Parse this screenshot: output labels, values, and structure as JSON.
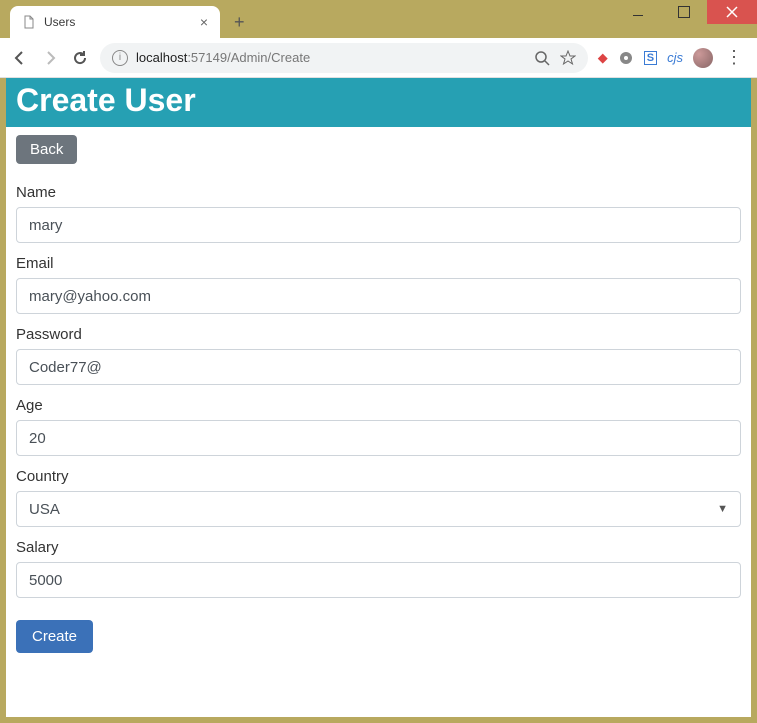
{
  "browser": {
    "tab_title": "Users",
    "url_host": "localhost",
    "url_port": ":57149",
    "url_path": "/Admin/Create",
    "ext_cjs": "cjs"
  },
  "page": {
    "heading": "Create User",
    "back_label": "Back",
    "submit_label": "Create"
  },
  "form": {
    "name": {
      "label": "Name",
      "value": "mary"
    },
    "email": {
      "label": "Email",
      "value": "mary@yahoo.com"
    },
    "password": {
      "label": "Password",
      "value": "Coder77@"
    },
    "age": {
      "label": "Age",
      "value": "20"
    },
    "country": {
      "label": "Country",
      "value": "USA"
    },
    "salary": {
      "label": "Salary",
      "value": "5000"
    }
  }
}
